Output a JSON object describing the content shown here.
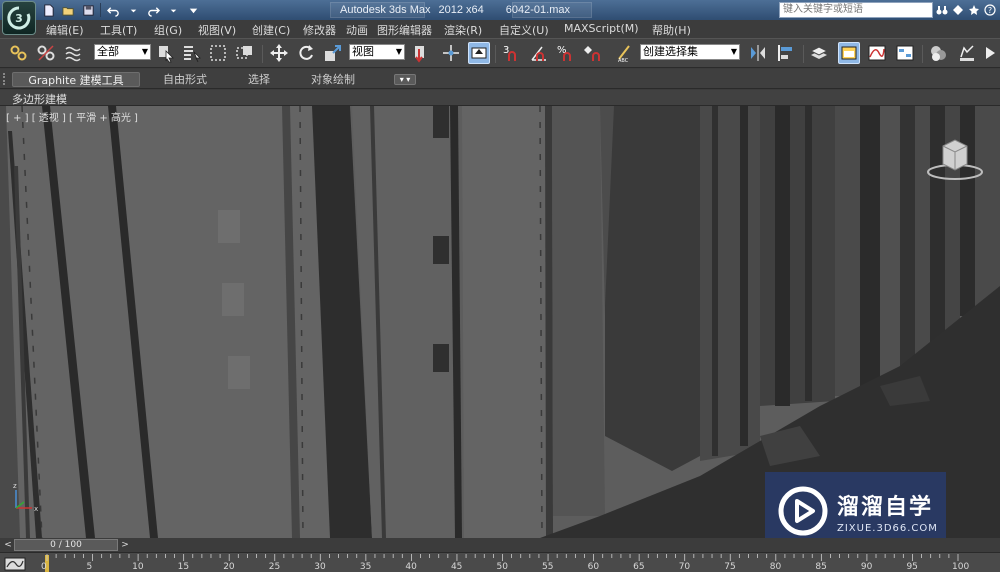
{
  "titlebar": {
    "app_name": "Autodesk 3ds Max",
    "version": "2012 x64",
    "file_name": "6042-01.max",
    "search_placeholder": "键入关键字或短语"
  },
  "menu": [
    {
      "label": "编辑(E)"
    },
    {
      "label": "工具(T)"
    },
    {
      "label": "组(G)"
    },
    {
      "label": "视图(V)"
    },
    {
      "label": "创建(C)"
    },
    {
      "label": "修改器"
    },
    {
      "label": "动画"
    },
    {
      "label": "图形编辑器"
    },
    {
      "label": "渲染(R)"
    },
    {
      "label": "自定义(U)"
    },
    {
      "label": "MAXScript(M)"
    },
    {
      "label": "帮助(H)"
    }
  ],
  "toolbar": {
    "selection_filter": "全部",
    "reference_coord": "视图",
    "named_selection": "创建选择集",
    "snap_labels": {
      "snap": "3",
      "angle": "",
      "percent": "%"
    }
  },
  "ribbon": {
    "tabs": [
      {
        "label": "Graphite 建模工具",
        "active": true
      },
      {
        "label": "自由形式",
        "active": false
      },
      {
        "label": "选择",
        "active": false
      },
      {
        "label": "对象绘制",
        "active": false
      }
    ],
    "panel_label": "多边形建模"
  },
  "viewport": {
    "label": "[ + ] [ 透视 ] [ 平滑 + 高光 ]"
  },
  "watermark": {
    "title": "溜溜自学",
    "url": "ZIXUE.3D66.COM"
  },
  "timeslider": {
    "frame_display": "0 / 100",
    "prev": "<",
    "next": ">"
  },
  "trackbar": {
    "ticks": [
      "0",
      "5",
      "10",
      "15",
      "20",
      "25",
      "30",
      "35",
      "40",
      "45",
      "50",
      "55",
      "60",
      "65",
      "70",
      "75",
      "80",
      "85",
      "90",
      "95",
      "100"
    ]
  },
  "colors": {
    "titlebar": "#3d5d84",
    "viewport_bg": "#5c5c5c",
    "active_tool": "#8fb8e6",
    "frame_cursor": "#d9b542",
    "watermark_bg": "#283c6e"
  }
}
